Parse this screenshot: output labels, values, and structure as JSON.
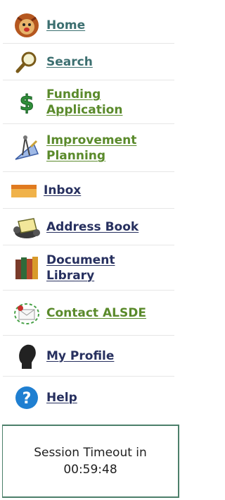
{
  "nav": {
    "home": {
      "label": "Home",
      "icon": "lion-mascot-icon"
    },
    "search": {
      "label": "Search",
      "icon": "magnifier-icon"
    },
    "funding": {
      "line1": "Funding",
      "line2": "Application",
      "icon": "dollar-sign-icon"
    },
    "improvement": {
      "line1": "Improvement",
      "line2": "Planning",
      "icon": "drafting-tools-icon"
    },
    "inbox": {
      "label": "Inbox",
      "icon": "inbox-tray-icon"
    },
    "address": {
      "label": "Address Book",
      "icon": "rolodex-icon"
    },
    "document": {
      "line1": "Document",
      "line2": "Library",
      "icon": "books-icon"
    },
    "contact": {
      "label": "Contact ALSDE",
      "icon": "envelope-icon"
    },
    "profile": {
      "label": "My Profile",
      "icon": "silhouette-head-icon"
    },
    "help": {
      "label": "Help",
      "icon": "question-circle-icon"
    }
  },
  "session": {
    "label": "Session Timeout in",
    "time": "00:59:48"
  },
  "colors": {
    "teal": "#3c6f70",
    "green": "#5a8a2b",
    "navy": "#27305f",
    "border": "#4c7f6a"
  }
}
